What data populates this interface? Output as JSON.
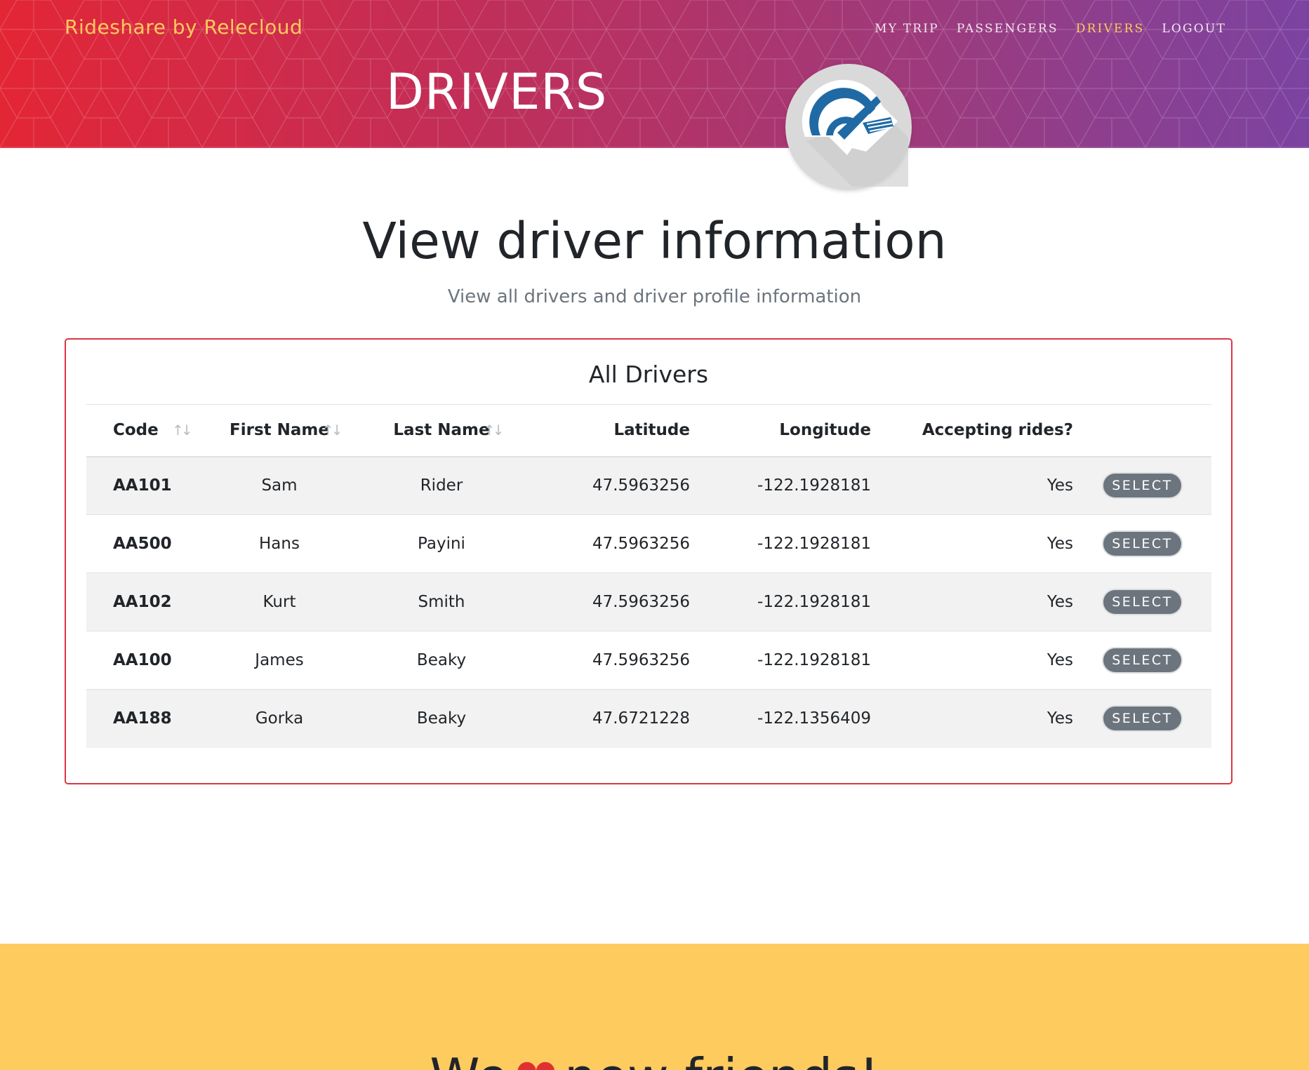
{
  "header": {
    "brand": "Rideshare by Relecloud",
    "nav": [
      {
        "label": "MY TRIP",
        "active": false
      },
      {
        "label": "PASSENGERS",
        "active": false
      },
      {
        "label": "DRIVERS",
        "active": true
      },
      {
        "label": "LOGOUT",
        "active": false
      }
    ],
    "heading": "DRIVERS",
    "badge_icon": "speedometer-icon"
  },
  "main": {
    "title": "View driver information",
    "subtitle": "View all drivers and driver profile information"
  },
  "card": {
    "title": "All Drivers",
    "columns": [
      "Code",
      "First Name",
      "Last Name",
      "Latitude",
      "Longitude",
      "Accepting rides?"
    ],
    "select_label": "SELECT",
    "rows": [
      {
        "code": "AA101",
        "first": "Sam",
        "last": "Rider",
        "lat": "47.5963256",
        "lon": "-122.1928181",
        "accepting": "Yes"
      },
      {
        "code": "AA500",
        "first": "Hans",
        "last": "Payini",
        "lat": "47.5963256",
        "lon": "-122.1928181",
        "accepting": "Yes"
      },
      {
        "code": "AA102",
        "first": "Kurt",
        "last": "Smith",
        "lat": "47.5963256",
        "lon": "-122.1928181",
        "accepting": "Yes"
      },
      {
        "code": "AA100",
        "first": "James",
        "last": "Beaky",
        "lat": "47.5963256",
        "lon": "-122.1928181",
        "accepting": "Yes"
      },
      {
        "code": "AA188",
        "first": "Gorka",
        "last": "Beaky",
        "lat": "47.6721228",
        "lon": "-122.1356409",
        "accepting": "Yes"
      }
    ]
  },
  "footer": {
    "tagline_before": "We",
    "tagline_after": "new friends!",
    "heart_icon": "heart-icon"
  },
  "colors": {
    "brand_accent": "#fdc95c",
    "card_border": "#dc3545",
    "button_bg": "#6c757d",
    "footer_bg": "#fecb5f",
    "heart": "#e03131"
  }
}
